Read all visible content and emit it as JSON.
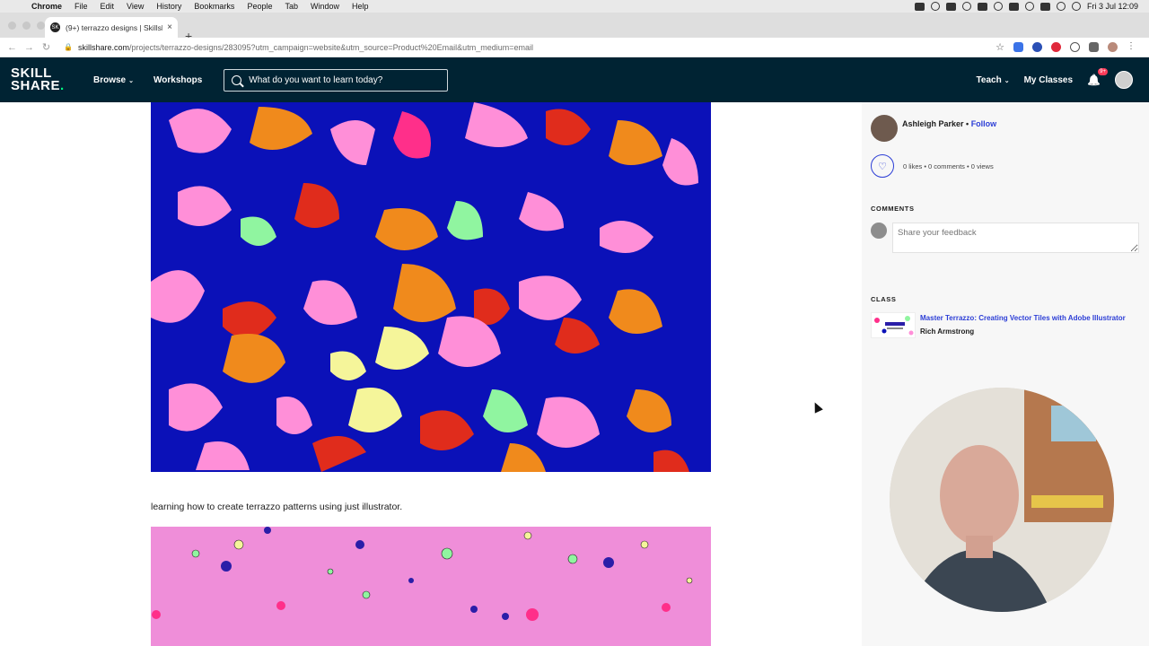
{
  "mac_menu": {
    "apple_glyph": "",
    "items": [
      "Chrome",
      "File",
      "Edit",
      "View",
      "History",
      "Bookmarks",
      "People",
      "Tab",
      "Window",
      "Help"
    ],
    "clock": "Fri 3 Jul  12:09"
  },
  "browser": {
    "tab": {
      "favicon_text": "SK",
      "title": "(9+) terrazzo designs | Skillsh",
      "close": "×"
    },
    "new_tab": "+",
    "back": "←",
    "forward": "→",
    "reload": "↻",
    "lock_glyph": "🔒",
    "url_host": "skillshare.com",
    "url_path": "/projects/terrazzo-designs/283095?utm_campaign=website&utm_source=Product%20Email&utm_medium=email",
    "star_glyph": "☆"
  },
  "header": {
    "logo_line1": "SKILL",
    "logo_line2": "SHARE",
    "logo_dot": ".",
    "browse_label": "Browse",
    "workshops_label": "Workshops",
    "search_placeholder": "What do you want to learn today?",
    "teach_label": "Teach",
    "my_classes_label": "My Classes",
    "notification_badge": "9+",
    "chevron": "⌄",
    "bell_glyph": "🔔"
  },
  "main": {
    "caption": "learning how to create terrazzo patterns using just illustrator."
  },
  "sidebar": {
    "author_name": "Ashleigh Parker",
    "follow_label": "Follow",
    "separator": " • ",
    "heart_glyph": "♡",
    "stats": "0 likes • 0 comments • 0 views",
    "comments_heading": "COMMENTS",
    "comment_placeholder": "Share your feedback",
    "class_heading": "CLASS",
    "class_title": "Master Terrazzo: Creating Vector Tiles with Adobe Illustrator",
    "class_author": "Rich Armstrong"
  },
  "colors": {
    "skillshare_navy": "#002333",
    "skillshare_green": "#00ff84",
    "link_blue": "#2c3ed6",
    "artwork_one_bg": "#0b11b8",
    "artwork_two_bg": "#ef8ed9"
  }
}
